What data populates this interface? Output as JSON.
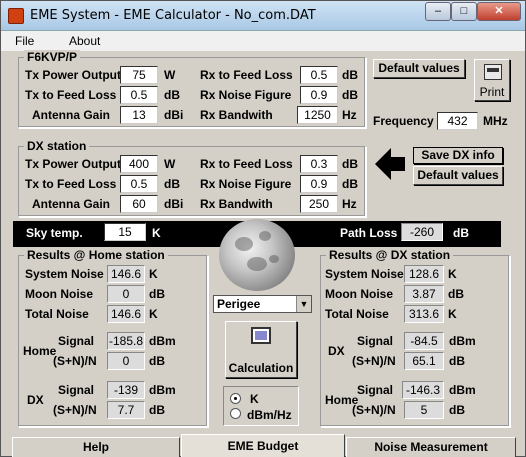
{
  "window": {
    "title": "EME System - EME Calculator - No_com.DAT"
  },
  "menu": {
    "file": "File",
    "about": "About"
  },
  "home_station": {
    "legend": "F6KVP/P",
    "tx_power_label": "Tx Power Output",
    "tx_power": "75",
    "tx_power_unit": "W",
    "tx_feed_label": "Tx to Feed Loss",
    "tx_feed": "0.5",
    "tx_feed_unit": "dB",
    "ant_gain_label": "Antenna Gain",
    "ant_gain": "13",
    "ant_gain_unit": "dBi",
    "rx_feed_label": "Rx to Feed Loss",
    "rx_feed": "0.5",
    "rx_feed_unit": "dB",
    "rx_nf_label": "Rx Noise Figure",
    "rx_nf": "0.9",
    "rx_nf_unit": "dB",
    "rx_bw_label": "Rx Bandwith",
    "rx_bw": "1250",
    "rx_bw_unit": "Hz"
  },
  "buttons": {
    "default_values": "Default values",
    "print": "Print",
    "save_dx": "Save DX info",
    "dx_default_values": "Default values",
    "calculation": "Calculation"
  },
  "frequency": {
    "label": "Frequency",
    "value": "432",
    "unit": "MHz"
  },
  "dx_station": {
    "legend": "DX station",
    "tx_power_label": "Tx Power Output",
    "tx_power": "400",
    "tx_power_unit": "W",
    "tx_feed_label": "Tx to Feed Loss",
    "tx_feed": "0.5",
    "tx_feed_unit": "dB",
    "ant_gain_label": "Antenna Gain",
    "ant_gain": "60",
    "ant_gain_unit": "dBi",
    "rx_feed_label": "Rx to Feed Loss",
    "rx_feed": "0.3",
    "rx_feed_unit": "dB",
    "rx_nf_label": "Rx Noise Figure",
    "rx_nf": "0.9",
    "rx_nf_unit": "dB",
    "rx_bw_label": "Rx Bandwith",
    "rx_bw": "250",
    "rx_bw_unit": "Hz"
  },
  "sky": {
    "label": "Sky temp.",
    "value": "15",
    "unit": "K"
  },
  "path_loss": {
    "label": "Path Loss",
    "value": "-260",
    "unit": "dB"
  },
  "moon_position": {
    "selected": "Perigee"
  },
  "results_home": {
    "legend": "Results @ Home station",
    "system_noise_label": "System Noise",
    "system_noise": "146.6",
    "system_noise_unit": "K",
    "moon_noise_label": "Moon Noise",
    "moon_noise": "0",
    "moon_noise_unit": "dB",
    "total_noise_label": "Total Noise",
    "total_noise": "146.6",
    "total_noise_unit": "K",
    "home_label": "Home",
    "home_signal_label": "Signal",
    "home_signal": "-185.8",
    "home_signal_unit": "dBm",
    "home_sn_label": "(S+N)/N",
    "home_sn": "0",
    "home_sn_unit": "dB",
    "dx_label": "DX",
    "dx_signal_label": "Signal",
    "dx_signal": "-139",
    "dx_signal_unit": "dBm",
    "dx_sn_label": "(S+N)/N",
    "dx_sn": "7.7",
    "dx_sn_unit": "dB"
  },
  "results_dx": {
    "legend": "Results @ DX station",
    "system_noise_label": "System Noise",
    "system_noise": "128.6",
    "system_noise_unit": "K",
    "moon_noise_label": "Moon Noise",
    "moon_noise": "3.87",
    "moon_noise_unit": "dB",
    "total_noise_label": "Total Noise",
    "total_noise": "313.6",
    "total_noise_unit": "K",
    "dx_label": "DX",
    "dx_signal_label": "Signal",
    "dx_signal": "-84.5",
    "dx_signal_unit": "dBm",
    "dx_sn_label": "(S+N)/N",
    "dx_sn": "65.1",
    "dx_sn_unit": "dB",
    "home_label": "Home",
    "home_signal_label": "Signal",
    "home_signal": "-146.3",
    "home_signal_unit": "dBm",
    "home_sn_label": "(S+N)/N",
    "home_sn": "5",
    "home_sn_unit": "dB"
  },
  "units_radio": {
    "k_label": "K",
    "dbm_label": "dBm/Hz",
    "selected": "K"
  },
  "tabs": {
    "help": "Help",
    "eme_budget": "EME Budget",
    "noise": "Noise Measurement"
  }
}
